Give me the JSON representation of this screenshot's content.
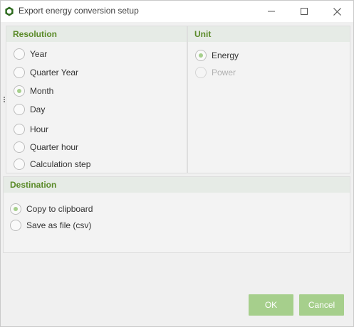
{
  "window": {
    "title": "Export energy conversion setup",
    "accent": "#5a8a28",
    "radio_checked_color": "#a6cf8c",
    "button_color": "#a6cf8c"
  },
  "titlebar_icons": [
    "app-icon",
    "minimize-icon",
    "maximize-icon",
    "close-icon"
  ],
  "resolution": {
    "header": "Resolution",
    "options": [
      {
        "label": "Year",
        "checked": false
      },
      {
        "label": "Quarter Year",
        "checked": false
      },
      {
        "label": "Month",
        "checked": true
      },
      {
        "label": "Day",
        "checked": false
      },
      {
        "label": "Hour",
        "checked": false
      },
      {
        "label": "Quarter hour",
        "checked": false
      },
      {
        "label": "Calculation step",
        "checked": false
      }
    ]
  },
  "unit": {
    "header": "Unit",
    "options": [
      {
        "label": "Energy",
        "checked": true,
        "disabled": false
      },
      {
        "label": "Power",
        "checked": false,
        "disabled": true
      }
    ]
  },
  "destination": {
    "header": "Destination",
    "options": [
      {
        "label": "Copy to clipboard",
        "checked": true
      },
      {
        "label": "Save as file (csv)",
        "checked": false
      }
    ]
  },
  "buttons": {
    "ok": "OK",
    "cancel": "Cancel"
  }
}
